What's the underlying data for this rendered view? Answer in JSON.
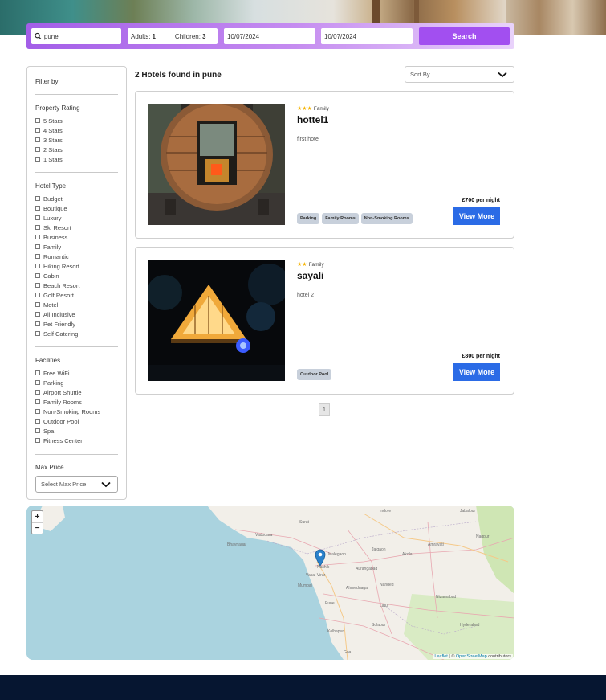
{
  "search": {
    "destination": "pune",
    "adults_label": "Adults:",
    "adults_value": "1",
    "children_label": "Children:",
    "children_value": "3",
    "check_in": "10/07/2024",
    "check_out": "10/07/2024",
    "button_label": "Search"
  },
  "filters": {
    "title": "Filter by:",
    "rating": {
      "heading": "Property Rating",
      "options": [
        "5 Stars",
        "4 Stars",
        "3 Stars",
        "2 Stars",
        "1 Stars"
      ]
    },
    "hotel_type": {
      "heading": "Hotel Type",
      "options": [
        "Budget",
        "Boutique",
        "Luxury",
        "Ski Resort",
        "Business",
        "Family",
        "Romantic",
        "Hiking Resort",
        "Cabin",
        "Beach Resort",
        "Golf Resort",
        "Motel",
        "All Inclusive",
        "Pet Friendly",
        "Self Catering"
      ]
    },
    "facilities": {
      "heading": "Facilities",
      "options": [
        "Free WiFi",
        "Parking",
        "Airport Shuttle",
        "Family Rooms",
        "Non-Smoking Rooms",
        "Outdoor Pool",
        "Spa",
        "Fitness Center"
      ]
    },
    "max_price": {
      "heading": "Max Price",
      "placeholder": "Select Max Price"
    }
  },
  "results": {
    "title": "2 Hotels found in pune",
    "sort_label": "Sort By",
    "hotels": [
      {
        "stars": "★★★",
        "type": "Family",
        "name": "hottel1",
        "description": "first hotel",
        "tags": [
          "Parking",
          "Family Rooms",
          "Non-Smoking Rooms"
        ],
        "price": "£700 per night",
        "button": "View More"
      },
      {
        "stars": "★★",
        "type": "Family",
        "name": "sayali",
        "description": "hotel 2",
        "tags": [
          "Outdoor Pool"
        ],
        "price": "£800 per night",
        "button": "View More"
      }
    ],
    "page": "1"
  },
  "map": {
    "zoom_in": "+",
    "zoom_out": "−",
    "attribution_leaflet": "Leaflet",
    "attribution_sep": " | © ",
    "attribution_osm": "OpenStreetMap",
    "attribution_tail": " contributors",
    "places": [
      "Surat",
      "Nashik",
      "Mumbai",
      "Pune",
      "Malegaon",
      "Vasai-Virar",
      "Jalgaon",
      "Aurangabad",
      "Ahmednagar",
      "Solapur",
      "Kolhapur",
      "Nanded",
      "Latur",
      "Akola",
      "Amravati",
      "Nagpur",
      "Nizamabad",
      "Hyderabad",
      "Indore",
      "Jabalpur",
      "Vadodara",
      "Bhavnagar",
      "Goa"
    ]
  },
  "colors": {
    "accent": "#a24ff0",
    "button_blue": "#2b6be6",
    "footer": "#061631",
    "star": "#f5b301"
  }
}
